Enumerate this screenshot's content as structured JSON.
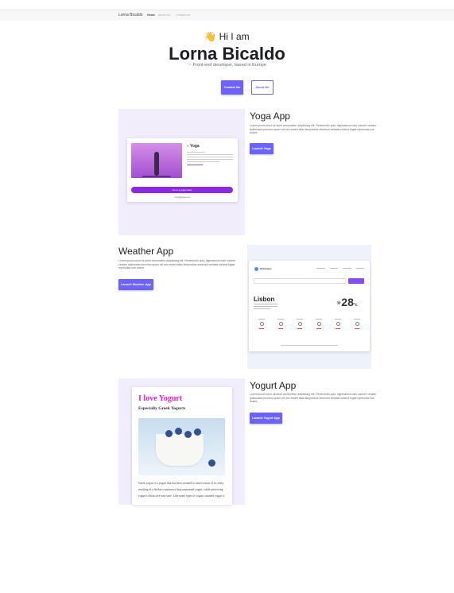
{
  "browser": {
    "strip_text": "' ' ' ' ' ' '"
  },
  "navbar": {
    "brand": "Lorna Bicaldo",
    "links": [
      "Home",
      "About me",
      "Contact me"
    ]
  },
  "hero": {
    "wave_emoji": "👋",
    "greeting": "Hi I am",
    "name": "Lorna Bicaldo",
    "subtitle": "Front-end developer, based in Europe",
    "contact_button": "Contact Me",
    "about_button": "About Me"
  },
  "projects": [
    {
      "title": "Yoga App",
      "description": "Lorem ipsum dolor sit amet consectetur adipisicing elit. Perferendis quia, dignissimos nam coloreri veniam quibusdam proximo quam vel nec essert alias temporibus deserunt veritatis minima fugiat reprhudas iure dolore",
      "button": "Launch Yoga",
      "preview": {
        "heading": "Yoga",
        "bar_label": "Go to a yoga class",
        "small_text": "lorna@yoga.com"
      }
    },
    {
      "title": "Weather App",
      "description": "Lorem ipsum dolor sit amet consectetur adipisicing elit. Perferendis quia, dignissimos nam coloreri veniam quibusdam proximo quam vel nec essert alias temporibus deserunt veritatis minima fugiat reprhudas iure dolore",
      "button": "Launch Weather App",
      "preview": {
        "brand": "SheCodes",
        "city": "Lisbon",
        "temperature": "28",
        "unit": "°c",
        "icon": "sun-icon"
      }
    },
    {
      "title": "Yogurt App",
      "description": "Lorem ipsum dolor sit amet consectetur adipisicing elit. Perferendis quia, dignissimos nam coloreri veniam quibusdam proximo quam vel nec essert alias temporibus deserunt veritatis minima fugiat reprhudas iure dolore",
      "button": "Launch Yogurt App",
      "preview": {
        "heading": "I love Yogurt",
        "subheading": "Especially Greek Yogurts",
        "body": "Greek yogurt is a yogurt that has been strained to remove most of its whey, resulting in a thicker consistency than unstrained yogurt, while preserving yogurt's distinctive sour taste. Like many types of yogurt, strained yogurt is"
      }
    }
  ],
  "colors": {
    "accent": "#6c63ff",
    "yogurt_pink": "#e620c7",
    "yoga_purple": "#8a2be2"
  }
}
